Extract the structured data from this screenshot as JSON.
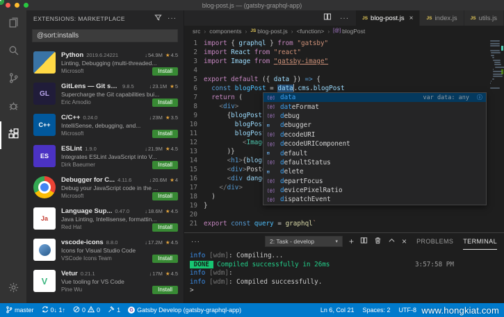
{
  "window": {
    "title": "blog-post.js — (gatsby-graphql-app)"
  },
  "activity_bar": {
    "items": [
      "explorer",
      "search",
      "source-control",
      "debug",
      "extensions"
    ],
    "active": "extensions",
    "bottom": [
      "settings"
    ]
  },
  "sidebar": {
    "header": "EXTENSIONS: MARKETPLACE",
    "search_value": "@sort:installs",
    "install_label": "Install",
    "extensions": [
      {
        "name": "Python",
        "version": "2019.6.24221",
        "installs": "54.9M",
        "rating": "4.5",
        "desc": "Linting, Debugging (multi-threaded...",
        "publisher": "Microsoft",
        "icon": "python",
        "monogram": ""
      },
      {
        "name": "GitLens — Git su...",
        "version": "9.8.5",
        "installs": "23.1M",
        "rating": "5",
        "desc": "Supercharge the Git capabilities bui...",
        "publisher": "Eric Amodio",
        "icon": "gitlens",
        "monogram": "GL"
      },
      {
        "name": "C/C++",
        "version": "0.24.0",
        "installs": "23M",
        "rating": "3.5",
        "desc": "IntelliSense, debugging, and...",
        "publisher": "Microsoft",
        "icon": "cpp",
        "monogram": "C++"
      },
      {
        "name": "ESLint",
        "version": "1.9.0",
        "installs": "21.9M",
        "rating": "4.5",
        "desc": "Integrates ESLint JavaScript into V...",
        "publisher": "Dirk Baeumer",
        "icon": "eslint",
        "monogram": "ES"
      },
      {
        "name": "Debugger for C...",
        "version": "4.11.6",
        "installs": "20.6M",
        "rating": "4",
        "desc": "Debug your JavaScript code in the ...",
        "publisher": "Microsoft",
        "icon": "chrome",
        "monogram": ""
      },
      {
        "name": "Language Sup...",
        "version": "0.47.0",
        "installs": "18.6M",
        "rating": "4.5",
        "desc": "Java Linting, Intellisense, formattin...",
        "publisher": "Red Hat",
        "icon": "java",
        "monogram": "Ja"
      },
      {
        "name": "vscode-icons",
        "version": "8.8.0",
        "installs": "17.2M",
        "rating": "4.5",
        "desc": "Icons for Visual Studio Code",
        "publisher": "VSCode Icons Team",
        "icon": "vsicons",
        "monogram": ""
      },
      {
        "name": "Vetur",
        "version": "0.21.1",
        "installs": "17M",
        "rating": "4.5",
        "desc": "Vue tooling for VS Code",
        "publisher": "Pine Wu",
        "icon": "vetur",
        "monogram": "V"
      }
    ]
  },
  "editor": {
    "tabs": [
      {
        "label": "blog-post.js",
        "active": true
      },
      {
        "label": "index.js"
      },
      {
        "label": "utils.js"
      }
    ],
    "breadcrumbs": [
      {
        "label": "src",
        "icon": "",
        "glyph": ""
      },
      {
        "label": "components",
        "icon": "",
        "glyph": ""
      },
      {
        "label": "blog-post.js",
        "icon": "js",
        "glyph": "JS"
      },
      {
        "label": "<function>",
        "icon": "",
        "glyph": ""
      },
      {
        "label": "blogPost",
        "icon": "sym",
        "glyph": "[@]"
      }
    ],
    "lines": [
      {
        "n": 1,
        "seg": [
          [
            "kw",
            "import "
          ],
          [
            "pn",
            "{ "
          ],
          [
            "vb",
            "graphql"
          ],
          [
            "pn",
            " } "
          ],
          [
            "kw",
            "from "
          ],
          [
            "st",
            "\"gatsby\""
          ]
        ]
      },
      {
        "n": 2,
        "seg": [
          [
            "kw",
            "import "
          ],
          [
            "vb",
            "React "
          ],
          [
            "kw",
            "from "
          ],
          [
            "st",
            "\"react\""
          ]
        ]
      },
      {
        "n": 3,
        "seg": [
          [
            "kw",
            "import "
          ],
          [
            "vb",
            "Image "
          ],
          [
            "kw",
            "from "
          ],
          [
            "stu",
            "\"gatsby-image\""
          ]
        ]
      },
      {
        "n": 4,
        "seg": []
      },
      {
        "n": 5,
        "seg": [
          [
            "kw",
            "export default "
          ],
          [
            "pn",
            "({ "
          ],
          [
            "vb",
            "data"
          ],
          [
            "pn",
            " }) "
          ],
          [
            "arr",
            "=> "
          ],
          [
            "pn",
            "{"
          ]
        ]
      },
      {
        "n": 6,
        "seg": [
          [
            "pn",
            "  "
          ],
          [
            "sb",
            "const "
          ],
          [
            "vc",
            "blogPost "
          ],
          [
            "pn",
            "= "
          ],
          [
            "vbh",
            "data"
          ],
          [
            "cur",
            ""
          ],
          [
            "pn",
            "."
          ],
          [
            "vb",
            "cms"
          ],
          [
            "pn",
            "."
          ],
          [
            "vb",
            "blogPost"
          ]
        ]
      },
      {
        "n": 7,
        "seg": [
          [
            "pn",
            "  "
          ],
          [
            "kw",
            "return "
          ],
          [
            "pn",
            "("
          ]
        ]
      },
      {
        "n": 8,
        "seg": [
          [
            "pn",
            "    "
          ],
          [
            "ab",
            "<"
          ],
          [
            "tag",
            "div"
          ],
          [
            "ab",
            ">"
          ]
        ]
      },
      {
        "n": 9,
        "seg": [
          [
            "pn",
            "      {"
          ],
          [
            "vb",
            "blogPost"
          ],
          [
            "pn",
            "."
          ],
          [
            "vb",
            "image"
          ],
          [
            "pn",
            " && ("
          ]
        ]
      },
      {
        "n": 10,
        "seg": [
          [
            "pn",
            "        "
          ],
          [
            "vb",
            "blogPost"
          ],
          [
            "pn",
            "."
          ],
          [
            "vb",
            "image"
          ],
          [
            "pn",
            " &&"
          ]
        ]
      },
      {
        "n": 11,
        "seg": [
          [
            "pn",
            "        "
          ],
          [
            "vb",
            "blogPost"
          ],
          [
            "pn",
            "."
          ],
          [
            "vb",
            "fluid"
          ],
          [
            "pn",
            " && ("
          ]
        ]
      },
      {
        "n": 12,
        "seg": [
          [
            "pn",
            "          "
          ],
          [
            "ab",
            "<"
          ],
          [
            "cmp",
            "Image"
          ],
          [
            "at",
            " fluid"
          ],
          [
            "pn",
            "={"
          ],
          [
            "vb",
            "blogPost"
          ],
          [
            "pn",
            "."
          ],
          [
            "vb",
            "image"
          ],
          [
            "pn",
            "."
          ],
          [
            "vb",
            "fluid"
          ],
          [
            "pn",
            "} "
          ],
          [
            "ab",
            "/>"
          ]
        ]
      },
      {
        "n": 13,
        "seg": [
          [
            "pn",
            "      )}"
          ]
        ]
      },
      {
        "n": 14,
        "seg": [
          [
            "pn",
            "      "
          ],
          [
            "ab",
            "<"
          ],
          [
            "tag",
            "h1"
          ],
          [
            "ab",
            ">"
          ],
          [
            "pn",
            "{"
          ],
          [
            "vb",
            "blogPost"
          ],
          [
            "pn",
            "."
          ],
          [
            "vb",
            "title"
          ],
          [
            "pn",
            "}"
          ],
          [
            "ab",
            "</"
          ],
          [
            "tag",
            "h1"
          ],
          [
            "ab",
            ">"
          ]
        ]
      },
      {
        "n": 15,
        "seg": [
          [
            "pn",
            "      "
          ],
          [
            "ab",
            "<"
          ],
          [
            "tag",
            "div"
          ],
          [
            "ab",
            ">"
          ],
          [
            "fg2",
            "Posted "
          ],
          [
            "pn",
            "{"
          ],
          [
            "vb",
            "blogPost"
          ],
          [
            "pn",
            "."
          ],
          [
            "vb",
            "date"
          ],
          [
            "pn",
            "}"
          ],
          [
            "ab",
            "</"
          ],
          [
            "tag",
            "div"
          ],
          [
            "ab",
            ">"
          ]
        ]
      },
      {
        "n": 16,
        "seg": [
          [
            "pn",
            "      "
          ],
          [
            "ab",
            "<"
          ],
          [
            "tag",
            "div"
          ],
          [
            "at",
            " dangerouslySetInnerHTML"
          ],
          [
            "pn",
            "={{ "
          ],
          [
            "vb",
            "__html"
          ],
          [
            "pn",
            ": "
          ],
          [
            "vb",
            "blogPost"
          ],
          [
            "pn",
            "."
          ],
          [
            "vb",
            "body"
          ],
          [
            "pn",
            " }} "
          ],
          [
            "ab",
            "/>"
          ]
        ]
      },
      {
        "n": 17,
        "seg": [
          [
            "pn",
            "    "
          ],
          [
            "ab",
            "</"
          ],
          [
            "tag",
            "div"
          ],
          [
            "ab",
            ">"
          ]
        ]
      },
      {
        "n": 18,
        "seg": [
          [
            "pn",
            "  )"
          ]
        ]
      },
      {
        "n": 19,
        "seg": [
          [
            "pn",
            "}"
          ]
        ]
      },
      {
        "n": 20,
        "seg": []
      },
      {
        "n": 21,
        "seg": [
          [
            "kw",
            "export "
          ],
          [
            "sb",
            "const "
          ],
          [
            "vc",
            "query "
          ],
          [
            "pn",
            "= "
          ],
          [
            "fn",
            "graphql"
          ],
          [
            "st",
            "`"
          ]
        ]
      }
    ]
  },
  "suggest": {
    "items": [
      {
        "label": "data",
        "icon": "var",
        "hl": 4,
        "selected": true,
        "detail": "var data: any"
      },
      {
        "label": "dateFormat",
        "icon": "var",
        "hl": 3
      },
      {
        "label": "debug",
        "icon": "var",
        "hl": 1
      },
      {
        "label": "debugger",
        "icon": "kw",
        "hl": 1
      },
      {
        "label": "decodeURI",
        "icon": "var",
        "hl": 1
      },
      {
        "label": "decodeURIComponent",
        "icon": "var",
        "hl": 1
      },
      {
        "label": "default",
        "icon": "kw",
        "hl": 1
      },
      {
        "label": "defaultStatus",
        "icon": "var",
        "hl": 1
      },
      {
        "label": "delete",
        "icon": "kw",
        "hl": 1
      },
      {
        "label": "departFocus",
        "icon": "var",
        "hl": 1
      },
      {
        "label": "devicePixelRatio",
        "icon": "var",
        "hl": 1
      },
      {
        "label": "dispatchEvent",
        "icon": "var",
        "hl": 1
      }
    ]
  },
  "panel": {
    "tabs": [
      {
        "label": "PROBLEMS"
      },
      {
        "label": "TERMINAL",
        "active": true
      }
    ],
    "task_select": "2: Task - develop",
    "terminal_lines": [
      {
        "seg": [
          [
            "info",
            "info"
          ],
          [
            "dim",
            " [wdm]"
          ],
          [
            "fg",
            ": Compiling..."
          ]
        ]
      },
      {
        "seg": [
          [
            "done",
            " DONE "
          ],
          [
            "green",
            " Compiled successfully in 26ms"
          ]
        ],
        "right": "3:57:58 PM"
      },
      {
        "seg": [
          [
            "info",
            "info"
          ],
          [
            "dim",
            " [wdm]"
          ],
          [
            "fg",
            ":"
          ]
        ]
      },
      {
        "seg": [
          [
            "info",
            "info"
          ],
          [
            "dim",
            " [wdm]"
          ],
          [
            "fg",
            ": Compiled successfully."
          ]
        ]
      },
      {
        "seg": [
          [
            "fg",
            ">"
          ]
        ]
      }
    ]
  },
  "status_bar": {
    "branch": "master",
    "sync": "0↓ 1↑",
    "errors": "0",
    "warnings": "0",
    "tasks": "1",
    "app": "Gatsby Develop (gatsby-graphql-app)",
    "line_col": "Ln 6, Col 21",
    "indent": "Spaces: 2",
    "encoding": "UTF-8"
  },
  "watermark": "www.hongkiat.com",
  "colors": {
    "accent": "#007acc",
    "install_green": "#388a34",
    "done_green": "#17c672"
  }
}
